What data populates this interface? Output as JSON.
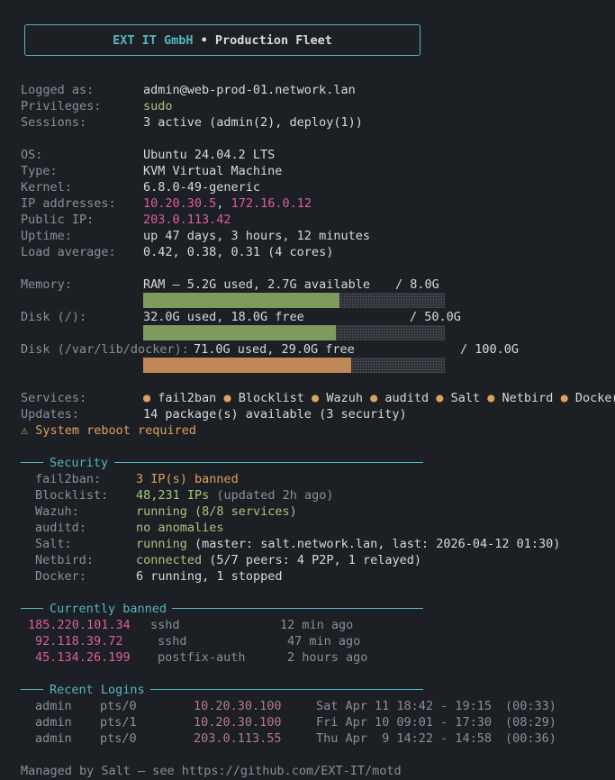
{
  "header": {
    "org": "EXT IT GmbH",
    "separator": "•",
    "title": "Production Fleet"
  },
  "login": {
    "logged_as_label": "Logged as:",
    "logged_as_value": "admin@web-prod-01.network.lan",
    "privileges_label": "Privileges:",
    "privileges_value": "sudo",
    "sessions_label": "Sessions:",
    "sessions_value": "3 active (admin(2), deploy(1))"
  },
  "system": {
    "os_label": "OS:",
    "os_value": "Ubuntu 24.04.2 LTS",
    "type_label": "Type:",
    "type_value": "KVM Virtual Machine",
    "kernel_label": "Kernel:",
    "kernel_value": "6.8.0-49-generic",
    "ip_label": "IP addresses:",
    "ip1": "10.20.30.5",
    "ip_sep": ",",
    "ip2": "172.16.0.12",
    "public_ip_label": "Public IP:",
    "public_ip_value": "203.0.113.42",
    "uptime_label": "Uptime:",
    "uptime_value": "up 47 days, 3 hours, 12 minutes",
    "load_label": "Load average:",
    "load_value": "0.42, 0.38, 0.31 (4 cores)"
  },
  "resources": {
    "memory_label": "Memory:",
    "memory_text": "RAM — 5.2G used, 2.7G available",
    "memory_total": "/ 8.0G",
    "memory_fraction": 0.65,
    "disk_root_label": "Disk (/):",
    "disk_root_text": "32.0G used, 18.0G free",
    "disk_root_total": "/ 50.0G",
    "disk_root_fraction": 0.64,
    "disk_docker_label": "Disk (/var/lib/docker):",
    "disk_docker_text": "71.0G used, 29.0G free",
    "disk_docker_total": "/ 100.0G",
    "disk_docker_fraction": 0.69,
    "colors": {
      "ok": "#7d9b5c",
      "warn": "#c1885a"
    }
  },
  "services": {
    "label": "Services:",
    "items": [
      "fail2ban",
      "Blocklist",
      "Wazuh",
      "auditd",
      "Salt",
      "Netbird",
      "Docker"
    ],
    "updates_label": "Updates:",
    "updates_value": "14 package(s) available (3 security)",
    "reboot_warning": "⚠ System reboot required"
  },
  "security": {
    "title": "Security",
    "fail2ban_label": "fail2ban:",
    "fail2ban_value": "3 IP(s) banned",
    "blocklist_label": "Blocklist:",
    "blocklist_value": "48,231 IPs",
    "blocklist_note": "(updated 2h ago)",
    "wazuh_label": "Wazuh:",
    "wazuh_value": "running (8/8 services)",
    "auditd_label": "auditd:",
    "auditd_value": "no anomalies",
    "salt_label": "Salt:",
    "salt_status": "running",
    "salt_detail": "(master: salt.network.lan, last: 2026-04-12 01:30)",
    "netbird_label": "Netbird:",
    "netbird_status": "connected",
    "netbird_detail": "(5/7 peers: 4 P2P, 1 relayed)",
    "docker_label": "Docker:",
    "docker_value": "6 running, 1 stopped"
  },
  "banned": {
    "title": "Currently banned",
    "rows": [
      {
        "ip": "185.220.101.34",
        "service": "sshd",
        "time": "12 min ago"
      },
      {
        "ip": "92.118.39.72",
        "service": "sshd",
        "time": "47 min ago"
      },
      {
        "ip": "45.134.26.199",
        "service": "postfix-auth",
        "time": "2 hours ago"
      }
    ]
  },
  "logins": {
    "title": "Recent Logins",
    "rows": [
      {
        "user": "admin",
        "tty": "pts/0",
        "ip": "10.20.30.100",
        "time": "Sat Apr 11 18:42 - 19:15",
        "duration": "(00:33)"
      },
      {
        "user": "admin",
        "tty": "pts/1",
        "ip": "10.20.30.100",
        "time": "Fri Apr 10 09:01 - 17:30",
        "duration": "(08:29)"
      },
      {
        "user": "admin",
        "tty": "pts/0",
        "ip": "203.0.113.55",
        "time": "Thu Apr  9 14:22 - 14:58",
        "duration": "(00:36)"
      }
    ]
  },
  "footer": {
    "text": "Managed by Salt — see https://github.com/EXT-IT/motd"
  }
}
